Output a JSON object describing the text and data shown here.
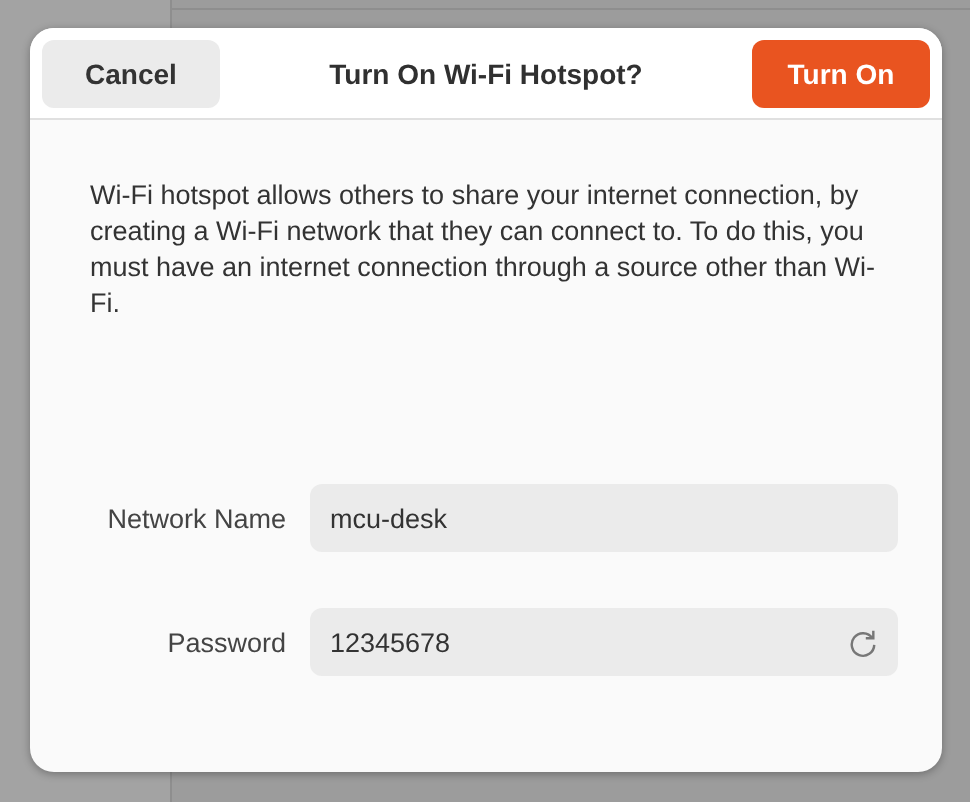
{
  "dialog": {
    "title": "Turn On Wi-Fi Hotspot?",
    "buttons": [
      {
        "kind": "cancel",
        "label": "Cancel"
      },
      {
        "kind": "suggested",
        "label": "Turn On"
      }
    ],
    "description": "Wi-Fi hotspot allows others to share your internet connection, by creating a Wi-Fi network that they can connect to. To do this, you must have an internet connection through a source other than Wi-Fi.",
    "fields": [
      {
        "label": "Network Name",
        "value": "mcu-desk",
        "kind": "text"
      },
      {
        "label": "Password",
        "value": "12345678",
        "kind": "password"
      }
    ]
  }
}
